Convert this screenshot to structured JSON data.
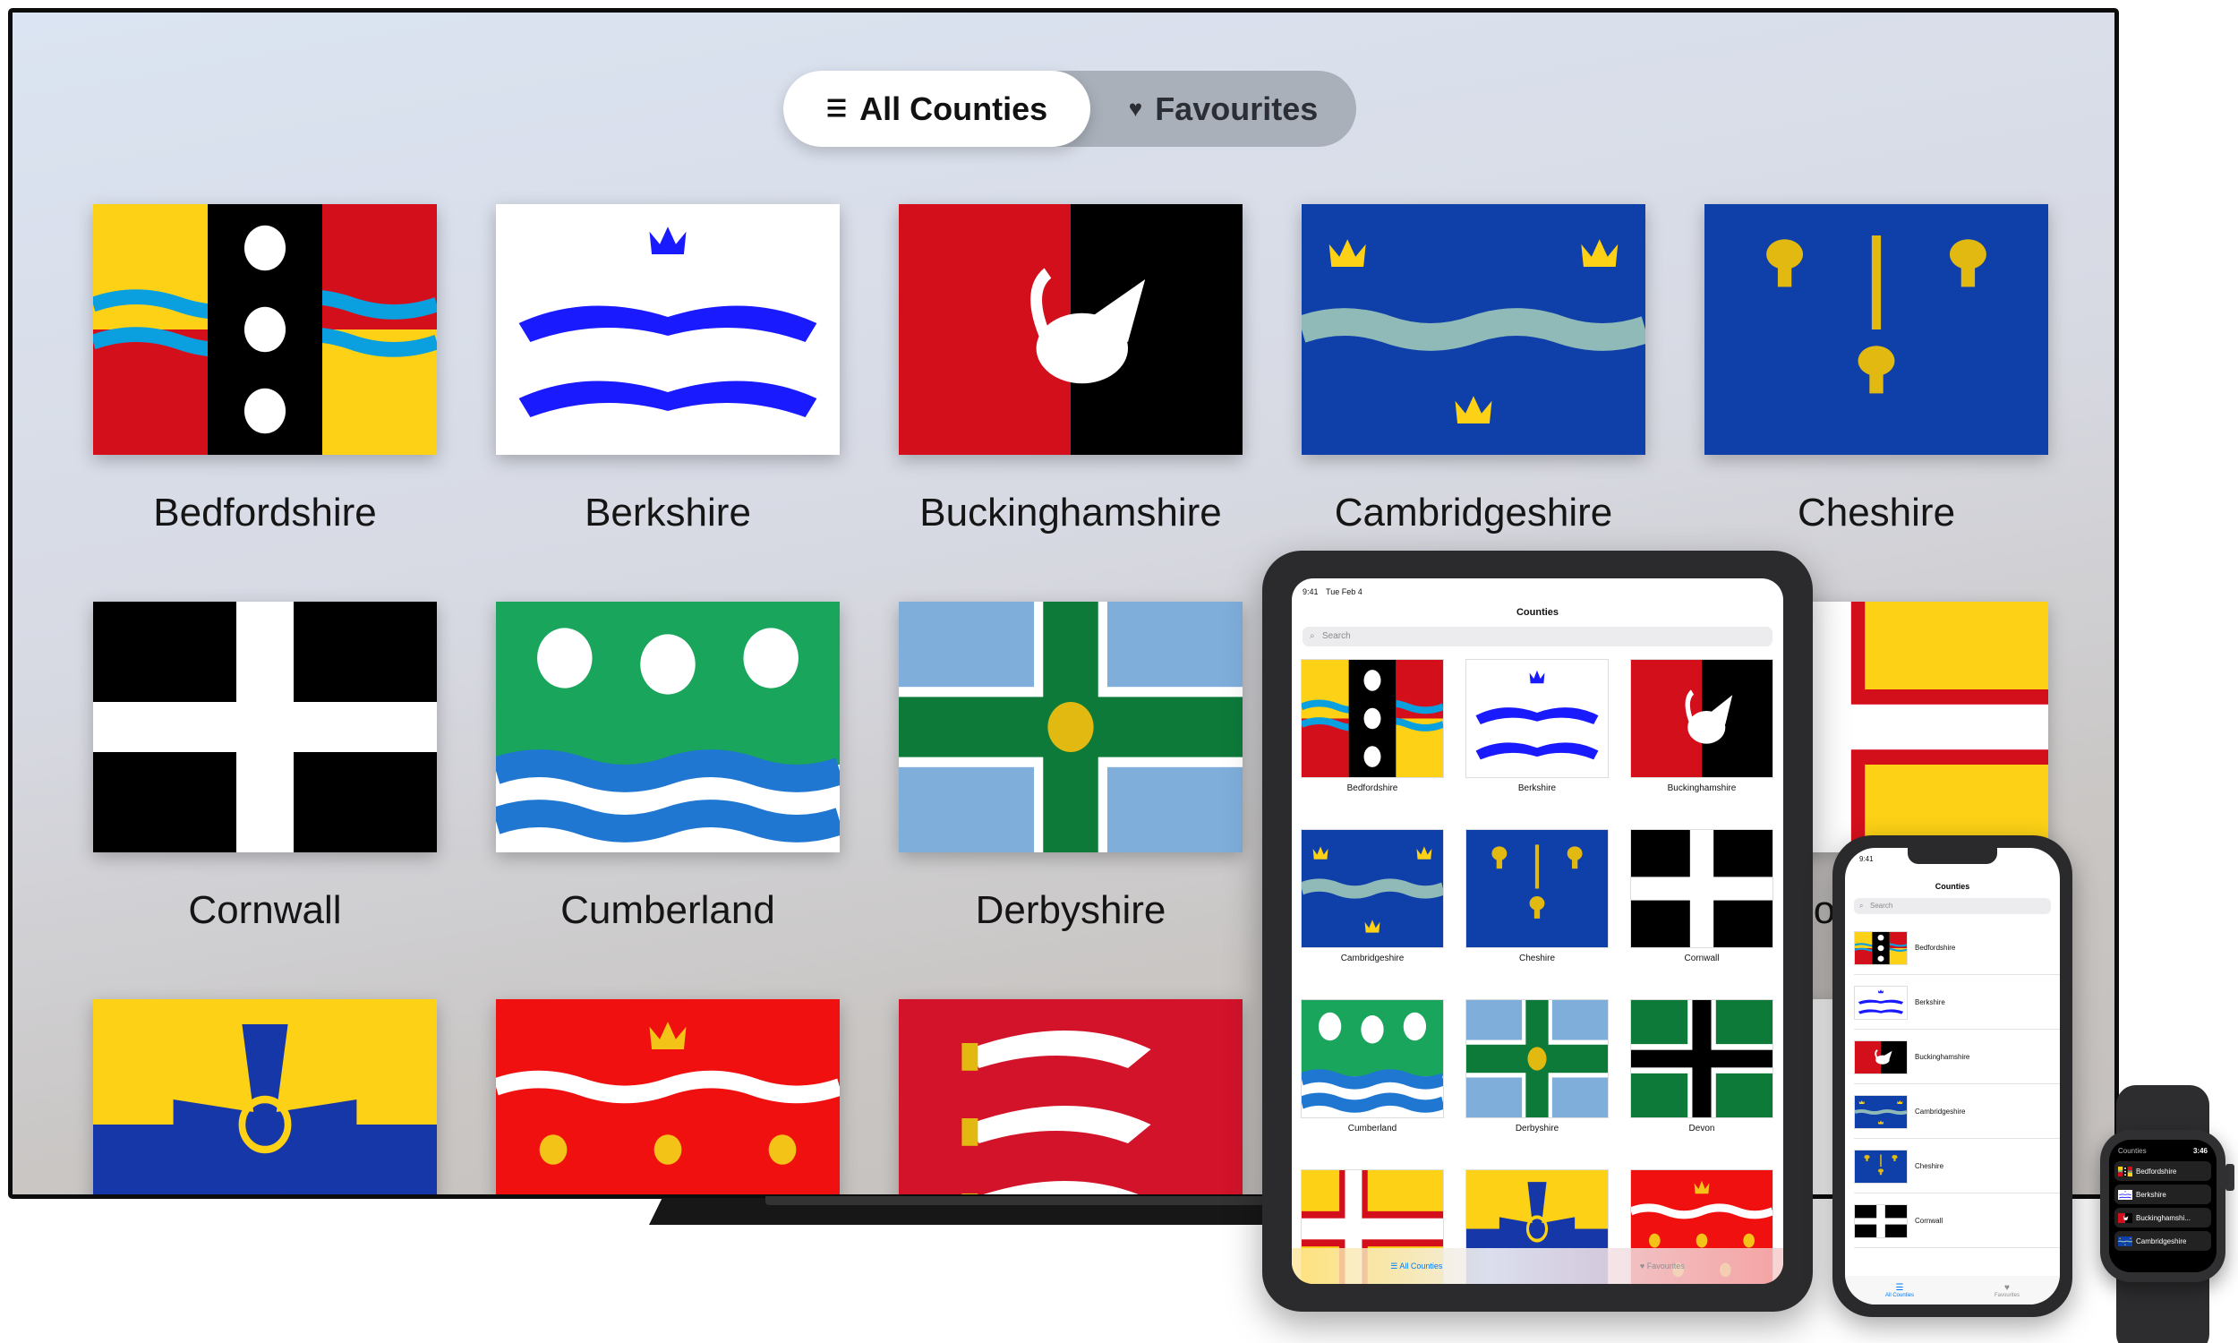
{
  "tv": {
    "segmented": {
      "all_label": "All Counties",
      "favourites_label": "Favourites"
    },
    "tiles": [
      {
        "label": "Bedfordshire",
        "flag": "bedfordshire"
      },
      {
        "label": "Berkshire",
        "flag": "berkshire"
      },
      {
        "label": "Buckinghamshire",
        "flag": "buckinghamshire"
      },
      {
        "label": "Cambridgeshire",
        "flag": "cambridgeshire"
      },
      {
        "label": "Cheshire",
        "flag": "cheshire"
      },
      {
        "label": "Cornwall",
        "flag": "cornwall"
      },
      {
        "label": "Cumberland",
        "flag": "cumberland"
      },
      {
        "label": "Derbyshire",
        "flag": "derbyshire"
      },
      {
        "label": "Do",
        "flag": "dorset"
      }
    ]
  },
  "ipad": {
    "status_time": "9:41",
    "status_date": "Tue Feb 4",
    "title": "Counties",
    "search_placeholder": "Search",
    "cells": [
      {
        "label": "Bedfordshire",
        "flag": "bedfordshire"
      },
      {
        "label": "Berkshire",
        "flag": "berkshire"
      },
      {
        "label": "Buckinghamshire",
        "flag": "buckinghamshire"
      },
      {
        "label": "Cambridgeshire",
        "flag": "cambridgeshire"
      },
      {
        "label": "Cheshire",
        "flag": "cheshire"
      },
      {
        "label": "Cornwall",
        "flag": "cornwall"
      },
      {
        "label": "Cumberland",
        "flag": "cumberland"
      },
      {
        "label": "Derbyshire",
        "flag": "derbyshire"
      },
      {
        "label": "Devon",
        "flag": "devon"
      }
    ],
    "tab_all": "All Counties",
    "tab_fav": "Favourites"
  },
  "iphone": {
    "status_time": "9:41",
    "title": "Counties",
    "search_placeholder": "Search",
    "rows": [
      {
        "label": "Bedfordshire",
        "flag": "bedfordshire"
      },
      {
        "label": "Berkshire",
        "flag": "berkshire"
      },
      {
        "label": "Buckinghamshire",
        "flag": "buckinghamshire"
      },
      {
        "label": "Cambridgeshire",
        "flag": "cambridgeshire"
      },
      {
        "label": "Cheshire",
        "flag": "cheshire"
      },
      {
        "label": "Cornwall",
        "flag": "cornwall"
      }
    ],
    "tab_all": "All Counties",
    "tab_fav": "Favourites"
  },
  "watch": {
    "title": "Counties",
    "time": "3:46",
    "rows": [
      {
        "label": "Bedfordshire",
        "flag": "bedfordshire"
      },
      {
        "label": "Berkshire",
        "flag": "berkshire"
      },
      {
        "label": "Buckinghamshi...",
        "flag": "buckinghamshire"
      },
      {
        "label": "Cambridgeshire",
        "flag": "cambridgeshire"
      }
    ]
  },
  "colors": {
    "accent": "#007aff",
    "flag_yellow": "#fcd116",
    "flag_red": "#d40f1c",
    "flag_blue": "#0f3fa8",
    "flag_green": "#19a55c"
  }
}
